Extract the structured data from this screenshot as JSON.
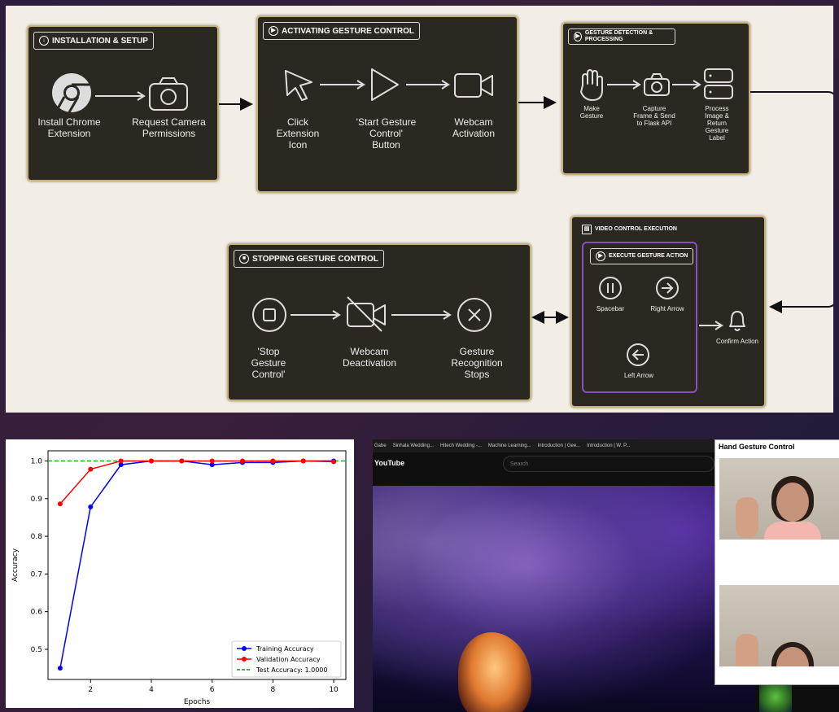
{
  "diagram": {
    "install": {
      "title": "INSTALLATION & SETUP",
      "step1": "Install Chrome Extension",
      "step2": "Request Camera Permissions"
    },
    "activate": {
      "title": "ACTIVATING GESTURE CONTROL",
      "step1": "Click Extension Icon",
      "step2": "'Start Gesture Control' Button",
      "step3": "Webcam Activation"
    },
    "detect": {
      "title": "GESTURE DETECTION & PROCESSING",
      "step1": "Make Gesture",
      "step2": "Capture Frame & Send to Flask API",
      "step3": "Process Image & Return Gesture Label"
    },
    "video": {
      "title": "VIDEO CONTROL EXECUTION",
      "inner_title": "EXECUTE GESTURE ACTION",
      "a1": "Spacebar",
      "a2": "Right Arrow",
      "a3": "Left Arrow",
      "confirm": "Confirm Action"
    },
    "stop": {
      "title": "STOPPING GESTURE CONTROL",
      "step1": "'Stop Gesture Control'",
      "step2": "Webcam Deactivation",
      "step3": "Gesture Recognition Stops"
    }
  },
  "chart_data": {
    "type": "line",
    "x": [
      1,
      2,
      3,
      4,
      5,
      6,
      7,
      8,
      9,
      10
    ],
    "series": [
      {
        "name": "Training Accuracy",
        "color": "#0000ff",
        "values": [
          0.45,
          0.878,
          0.99,
          1.0,
          1.0,
          0.99,
          0.996,
          0.996,
          1.0,
          1.0
        ]
      },
      {
        "name": "Validation Accuracy",
        "color": "#ff0000",
        "values": [
          0.886,
          0.978,
          1.0,
          1.0,
          1.0,
          1.0,
          1.0,
          1.0,
          1.0,
          0.998
        ]
      }
    ],
    "hline": {
      "name": "Test Accuracy: 1.0000",
      "value": 1.0,
      "color": "#00a000"
    },
    "xlabel": "Epochs",
    "ylabel": "Accuracy",
    "xticks": [
      2,
      4,
      6,
      8,
      10
    ],
    "yticks": [
      0.5,
      0.6,
      0.7,
      0.8,
      0.9,
      1.0
    ],
    "xlim": [
      0.6,
      10.4
    ],
    "ylim": [
      0.42,
      1.027
    ],
    "legend": "lower-right",
    "grid": false
  },
  "browser": {
    "tabs": [
      "Gabe",
      "Sinhala Wedding...",
      "Hitech Wedding -...",
      "Machine Learning...",
      "Introduction | Gee...",
      "Introduction | W. P..."
    ],
    "yt_logo": "YouTube",
    "search_placeholder": "Search",
    "panel_title": "Hand Gesture Control"
  }
}
